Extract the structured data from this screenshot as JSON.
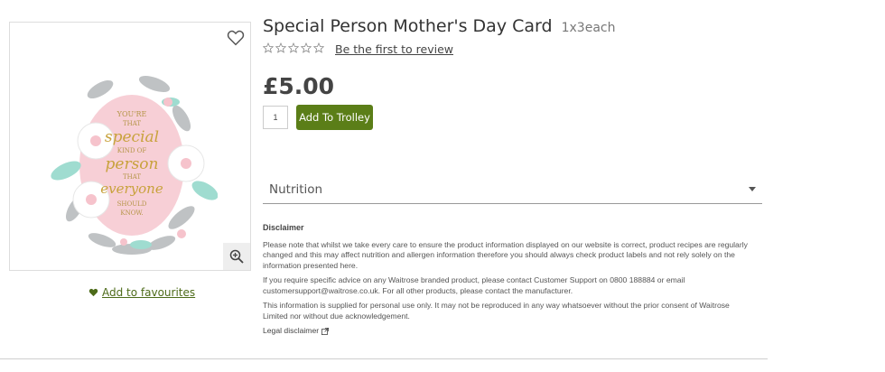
{
  "product": {
    "title": "Special Person Mother's Day Card",
    "size": "1x3each",
    "rating_stars": 0,
    "review_link": "Be the first to review",
    "price": "£5.00",
    "quantity": "1",
    "add_button": "Add To Trolley",
    "favourites_link": "Add to favourites",
    "card_text": [
      "YOU'RE",
      "THAT",
      "special",
      "KIND OF",
      "person",
      "THAT",
      "everyone",
      "SHOULD",
      "KNOW."
    ]
  },
  "accordion": {
    "nutrition_label": "Nutrition"
  },
  "disclaimer": {
    "heading": "Disclaimer",
    "p1": "Please note that whilst we take every care to ensure the product information displayed on our website is correct, product recipes are regularly changed and this may affect nutrition and allergen information therefore you should always check product labels and not rely solely on the information presented here.",
    "p2": "If you require specific advice on any Waitrose branded product, please contact Customer Support on 0800 188884 or email customersupport@waitrose.co.uk. For all other products, please contact the manufacturer.",
    "p3": "This information is supplied for personal use only. It may not be reproduced in any way whatsoever without the prior consent of Waitrose Limited nor without due acknowledgement.",
    "legal_link": "Legal disclaimer"
  },
  "colors": {
    "brand_green": "#5b7e18",
    "link_green": "#4d6b19"
  }
}
